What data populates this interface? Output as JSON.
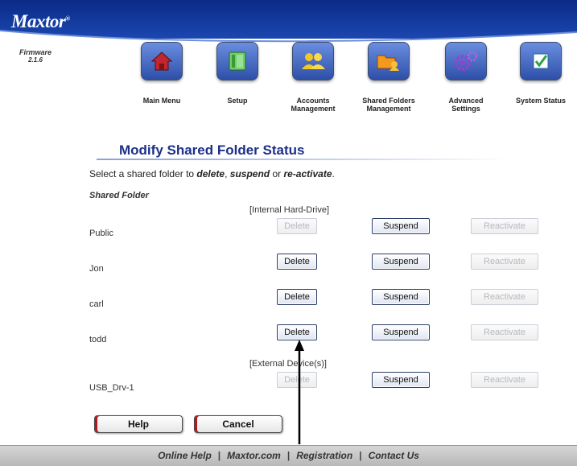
{
  "header": {
    "logo": "Maxtor",
    "firmware_label": "Firmware",
    "firmware_version": "2.1.6"
  },
  "nav": [
    {
      "label": "Main Menu",
      "icon": "home-icon"
    },
    {
      "label": "Setup",
      "icon": "drive-icon"
    },
    {
      "label": "Accounts Management",
      "icon": "users-icon"
    },
    {
      "label": "Shared Folders Management",
      "icon": "shared-folders-icon"
    },
    {
      "label": "Advanced Settings",
      "icon": "gears-icon"
    },
    {
      "label": "System Status",
      "icon": "checkmark-icon"
    }
  ],
  "page": {
    "title": "Modify Shared Folder Status",
    "instruction_prefix": "Select a shared folder to ",
    "instruction_delete": "delete",
    "instruction_sep1": ", ",
    "instruction_suspend": "suspend",
    "instruction_sep2": " or ",
    "instruction_reactivate": "re-activate",
    "instruction_end": ".",
    "column_heading": "Shared Folder",
    "internal_label": "[Internal Hard-Drive]",
    "external_label": "[External Device(s)]"
  },
  "buttons": {
    "delete": "Delete",
    "suspend": "Suspend",
    "reactivate": "Reactivate",
    "help": "Help",
    "cancel": "Cancel"
  },
  "folders": [
    {
      "name": "Public",
      "delete_enabled": false,
      "suspend_enabled": true,
      "reactivate_enabled": false
    },
    {
      "name": "Jon",
      "delete_enabled": true,
      "suspend_enabled": true,
      "reactivate_enabled": false
    },
    {
      "name": "carl",
      "delete_enabled": true,
      "suspend_enabled": true,
      "reactivate_enabled": false
    },
    {
      "name": "todd",
      "delete_enabled": true,
      "suspend_enabled": true,
      "reactivate_enabled": false
    },
    {
      "name": "USB_Drv-1",
      "delete_enabled": false,
      "suspend_enabled": true,
      "reactivate_enabled": false
    }
  ],
  "footer": {
    "links": [
      "Online Help",
      "Maxtor.com",
      "Registration",
      "Contact Us"
    ],
    "separator": "|"
  },
  "colors": {
    "header_blue": "#133a9e",
    "title_blue": "#1c2f8a",
    "accent_red": "#b3161d"
  }
}
